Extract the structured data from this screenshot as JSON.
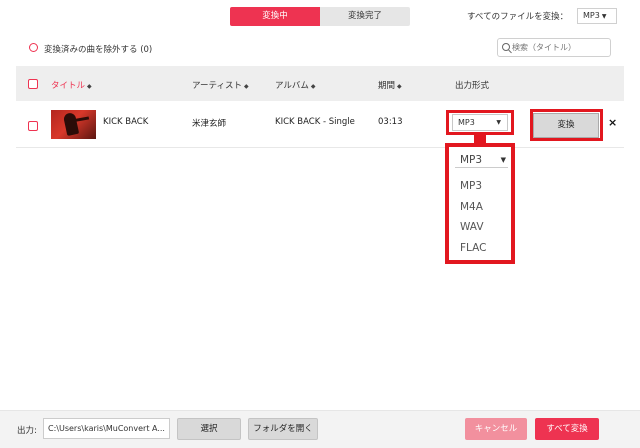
{
  "tabs": {
    "converting": "変換中",
    "converted": "変換完了"
  },
  "convert_all_files_label": "すべてのファイルを変換：",
  "global_format": {
    "value": "MP3"
  },
  "exclude_label": "変換済みの曲を除外する (0)",
  "search": {
    "placeholder": "検索（タイトル）"
  },
  "table": {
    "headers": {
      "title": "タイトル",
      "artist": "アーティスト",
      "album": "アルバム",
      "duration": "期間",
      "format": "出力形式"
    },
    "rows": [
      {
        "title": "KICK BACK",
        "artist": "米津玄師",
        "album": "KICK BACK - Single",
        "duration": "03:13",
        "format": "MP3",
        "convert_label": "変換"
      }
    ]
  },
  "format_dropdown": {
    "selected": "MP3",
    "options": [
      "MP3",
      "M4A",
      "WAV",
      "FLAC"
    ]
  },
  "bottom": {
    "output_label": "出力:",
    "output_path": "C:\\Users\\karis\\MuConvert A...",
    "select_label": "選択",
    "open_folder_label": "フォルダを開く",
    "cancel_label": "キャンセル",
    "convert_all_label": "すべて変換"
  },
  "colors": {
    "accent": "#ee3351",
    "highlight": "#e2171f",
    "cancel": "#f2909e"
  },
  "icons": [
    "search-icon",
    "sort-icon",
    "chevron-down-icon",
    "close-icon",
    "checkbox-icon",
    "radio-icon"
  ]
}
